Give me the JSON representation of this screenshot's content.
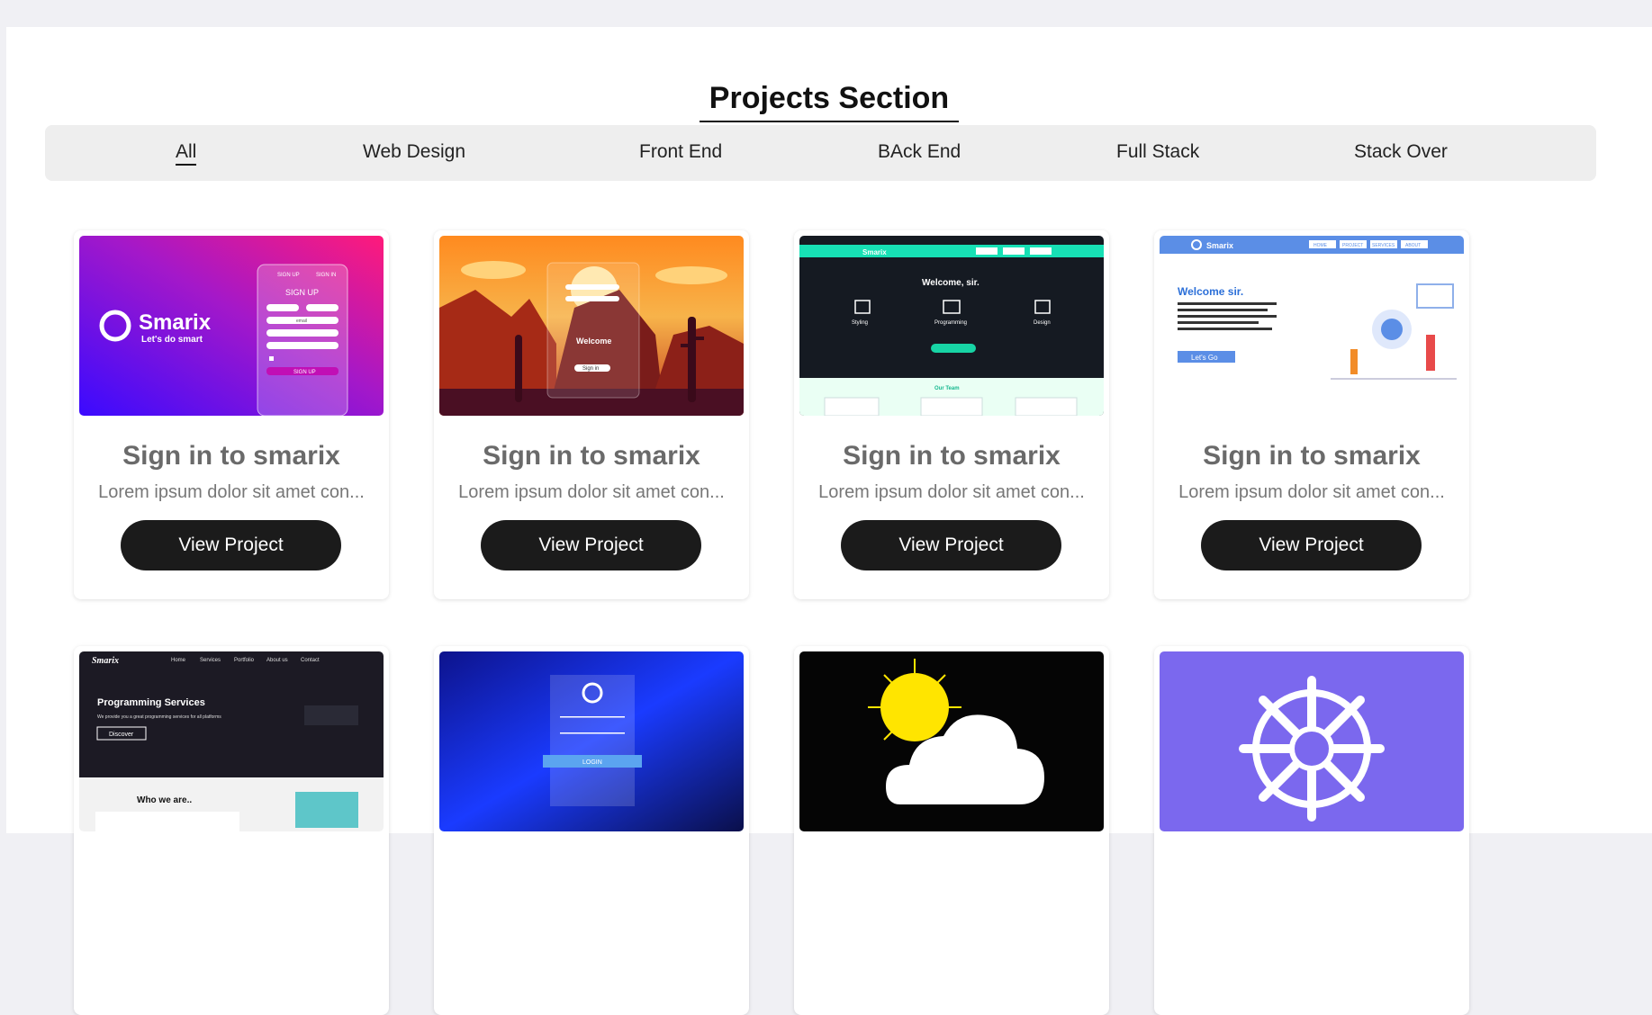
{
  "section": {
    "title": "Projects Section"
  },
  "filters": [
    "All",
    "Web Design",
    "Front End",
    "BAck End",
    "Full Stack",
    "Stack Over"
  ],
  "active_filter": "All",
  "cards": [
    {
      "title": "Sign in to smarix",
      "description": "Lorem ipsum dolor sit amet con...",
      "button": "View Project",
      "thumb": {
        "brand": "Smarix",
        "tagline": "Let's do smart",
        "tabs": [
          "SIGN UP",
          "SIGN IN"
        ],
        "heading": "SIGN UP",
        "fields": [
          "email"
        ],
        "submit": "SIGN UP"
      }
    },
    {
      "title": "Sign in to smarix",
      "description": "Lorem ipsum dolor sit amet con...",
      "button": "View Project",
      "thumb": {
        "heading": "Welcome",
        "submit": "Sign in"
      }
    },
    {
      "title": "Sign in to smarix",
      "description": "Lorem ipsum dolor sit amet con...",
      "button": "View Project",
      "thumb": {
        "brand": "Smarix",
        "heading": "Welcome, sir.",
        "services": [
          "Styling",
          "Programming",
          "Design"
        ],
        "section": "Our Team"
      }
    },
    {
      "title": "Sign in to smarix",
      "description": "Lorem ipsum dolor sit amet con...",
      "button": "View Project",
      "thumb": {
        "brand": "Smarix",
        "nav": [
          "HOME",
          "PROJECT",
          "SERVICES",
          "ABOUT"
        ],
        "heading": "Welcome sir.",
        "cta": "Let's Go"
      }
    },
    {
      "thumb": {
        "brand": "Smarix",
        "nav": [
          "Home",
          "Services",
          "Portfolio",
          "About us",
          "Contact"
        ],
        "heading": "Programming Services",
        "tagline": "We provide you a great programming services for all platforms",
        "cta": "Discover",
        "section": "Who we are.."
      }
    },
    {
      "thumb": {
        "submit": "LOGIN"
      }
    },
    {
      "thumb": {}
    },
    {
      "thumb": {}
    }
  ],
  "colors": {
    "button": "#1b1b1b",
    "filterbar": "#eeeeee",
    "page_bg": "#f0f0f4"
  }
}
